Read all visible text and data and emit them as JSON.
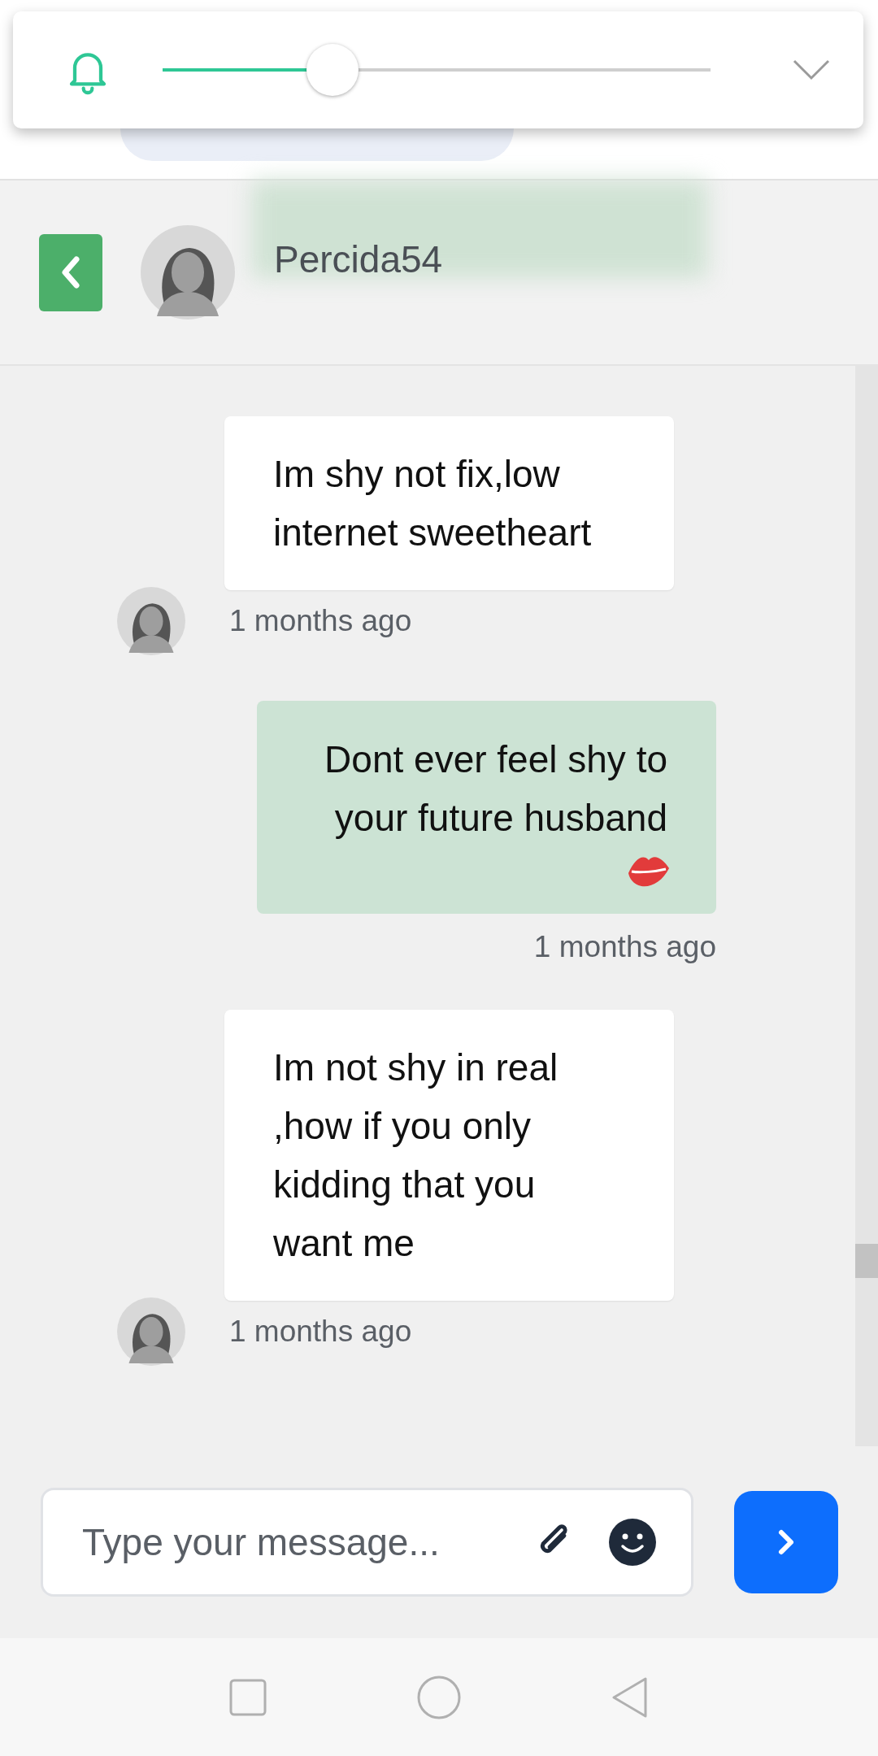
{
  "volume_popup": {
    "level": 0.31
  },
  "chat_header": {
    "name": "Percida54"
  },
  "messages": [
    {
      "kind": "received",
      "text": "Im shy not fix,low internet sweetheart",
      "time": "1 months ago"
    },
    {
      "kind": "sent",
      "text": "Dont ever feel shy to your future husband",
      "time": "1 months ago"
    },
    {
      "kind": "received",
      "text": "Im not shy in real ,how if you only kidding that you want me",
      "time": "1 months ago"
    }
  ],
  "composer": {
    "placeholder": "Type your message..."
  }
}
